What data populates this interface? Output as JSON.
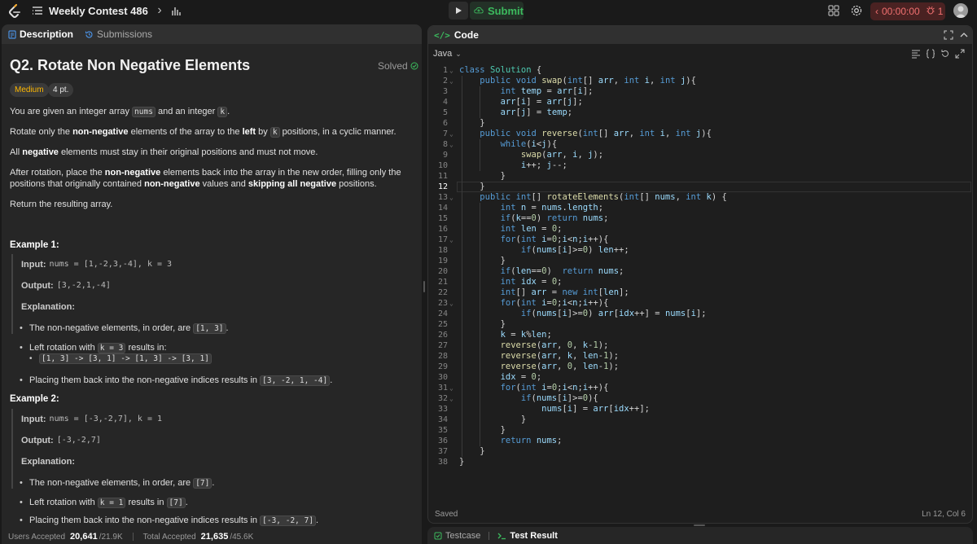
{
  "topbar": {
    "contest_title": "Weekly Contest 486",
    "submit_label": "Submit",
    "timer": "00:00:00",
    "alerts_count": "1"
  },
  "left": {
    "tabs": [
      {
        "label": "Description"
      },
      {
        "label": "Submissions"
      }
    ],
    "problem_title": "Q2. Rotate Non Negative Elements",
    "solved_label": "Solved",
    "difficulty": "Medium",
    "points": "4 pt.",
    "para1_a": "You are given an integer array",
    "para1_code1": "nums",
    "para1_b": "and an integer",
    "para1_code2": "k",
    "para1_c": ".",
    "para2_a": "Rotate only the",
    "para2_b": "non-negative",
    "para2_c": "elements of the array to the",
    "para2_d": "left",
    "para2_e": "by",
    "para2_code": "k",
    "para2_f": "positions, in a cyclic manner.",
    "para3_a": "All",
    "para3_b": "negative",
    "para3_c": "elements must stay in their original positions and must not move.",
    "para4_a": "After rotation, place the",
    "para4_b": "non-negative",
    "para4_c": "elements back into the array in the new order, filling only the positions that originally contained",
    "para4_d": "non-negative",
    "para4_e": "values and",
    "para4_f": "skipping all negative",
    "para4_g": "positions.",
    "para5": "Return the resulting array.",
    "example1": {
      "title": "Example 1:",
      "input_label": "Input:",
      "input_value": "nums = [1,-2,3,-4], k = 3",
      "output_label": "Output:",
      "output_value": "[3,-2,1,-4]",
      "explanation_label": "Explanation:",
      "b1_text": "The non-negative elements, in order, are",
      "b1_code": "[1, 3]",
      "b1_end": ".",
      "b2_text": "Left rotation with",
      "b2_code": "k = 3",
      "b2_end": "results in:",
      "b2_sub": "[1, 3] -> [3, 1] -> [1, 3] -> [3, 1]",
      "b3_text": "Placing them back into the non-negative indices results in",
      "b3_code": "[3, -2, 1, -4]",
      "b3_end": "."
    },
    "example2": {
      "title": "Example 2:",
      "input_label": "Input:",
      "input_value": "nums = [-3,-2,7], k = 1",
      "output_label": "Output:",
      "output_value": "[-3,-2,7]",
      "explanation_label": "Explanation:",
      "b1_text": "The non-negative elements, in order, are",
      "b1_code": "[7]",
      "b1_end": ".",
      "b2_text": "Left rotation with",
      "b2_code": "k = 1",
      "b2_end": "results in",
      "b2_code2": "[7]",
      "b2_end2": ".",
      "b3_text": "Placing them back into the non-negative indices results in",
      "b3_code": "[-3, -2, 7]",
      "b3_end": "."
    },
    "footer": {
      "users_label": "Users Accepted",
      "users_value": "20,641",
      "users_total": "/21.9K",
      "total_label": "Total Accepted",
      "total_value": "21,635",
      "total_total": "/45.6K"
    }
  },
  "code": {
    "title": "Code",
    "language": "Java",
    "status_left": "Saved",
    "status_right": "Ln 12, Col 6"
  },
  "bottom": {
    "tabs": [
      {
        "label": "Testcase"
      },
      {
        "label": "Test Result"
      }
    ]
  },
  "colors": {
    "accent_green": "#3cbb5e",
    "timer_red": "#f07070",
    "difficulty_medium": "#ffb800"
  }
}
